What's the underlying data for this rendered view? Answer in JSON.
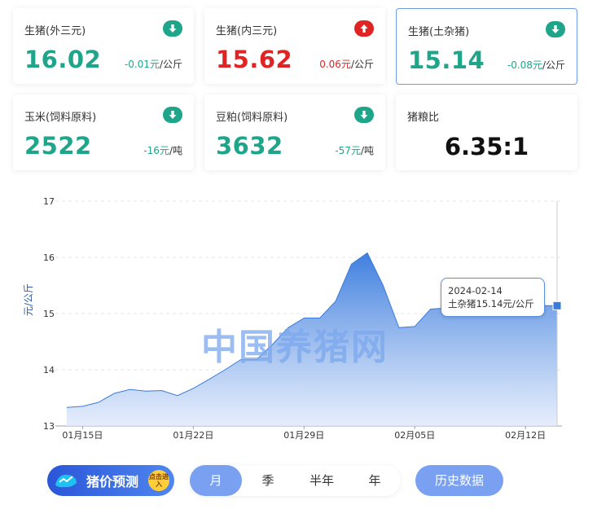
{
  "cards": [
    {
      "title": "生猪(外三元)",
      "price": "16.02",
      "change": "-0.01元",
      "unit": "/公斤",
      "trend": "down"
    },
    {
      "title": "生猪(内三元)",
      "price": "15.62",
      "change": "0.06元",
      "unit": "/公斤",
      "trend": "up"
    },
    {
      "title": "生猪(土杂猪)",
      "price": "15.14",
      "change": "-0.08元",
      "unit": "/公斤",
      "trend": "down"
    },
    {
      "title": "玉米(饲料原料)",
      "price": "2522",
      "change": "-16元",
      "unit": "/吨",
      "trend": "down"
    },
    {
      "title": "豆粕(饲料原料)",
      "price": "3632",
      "change": "-57元",
      "unit": "/吨",
      "trend": "down"
    },
    {
      "title": "猪粮比",
      "ratio": "6.35:1"
    }
  ],
  "colors": {
    "down": "#1ea58a",
    "up": "#e02424",
    "accent": "#7aa0f2",
    "line": "#3a7ad8"
  },
  "chart_data": {
    "type": "area",
    "ylabel": "元/公斤",
    "ylim": [
      13,
      17
    ],
    "yticks": [
      "13",
      "14",
      "15",
      "16",
      "17"
    ],
    "xticks": [
      "01月15日",
      "01月22日",
      "01月29日",
      "02月05日",
      "02月12日"
    ],
    "x": [
      "2024-01-14",
      "2024-01-15",
      "2024-01-16",
      "2024-01-17",
      "2024-01-18",
      "2024-01-19",
      "2024-01-20",
      "2024-01-21",
      "2024-01-22",
      "2024-01-23",
      "2024-01-24",
      "2024-01-25",
      "2024-01-26",
      "2024-01-27",
      "2024-01-28",
      "2024-01-29",
      "2024-01-30",
      "2024-01-31",
      "2024-02-01",
      "2024-02-02",
      "2024-02-03",
      "2024-02-04",
      "2024-02-05",
      "2024-02-06",
      "2024-02-07",
      "2024-02-08",
      "2024-02-09",
      "2024-02-10",
      "2024-02-11",
      "2024-02-12",
      "2024-02-13",
      "2024-02-14"
    ],
    "series": [
      {
        "name": "土杂猪",
        "values": [
          13.33,
          13.35,
          13.42,
          13.58,
          13.65,
          13.62,
          13.63,
          13.54,
          13.67,
          13.83,
          14.0,
          14.18,
          14.18,
          14.45,
          14.75,
          14.92,
          14.92,
          15.22,
          15.88,
          16.08,
          15.5,
          14.75,
          14.77,
          15.08,
          15.1,
          15.12,
          15.12,
          15.14,
          15.14,
          15.14,
          15.14,
          15.14
        ]
      }
    ],
    "tooltip": {
      "date": "2024-02-14",
      "text": "土杂猪15.14元/公斤"
    }
  },
  "watermark": "中国养猪网",
  "bottom": {
    "predict_label": "猪价预测",
    "predict_badge": "点击进入",
    "periods": [
      "月",
      "季",
      "半年",
      "年"
    ],
    "active_period": "月",
    "history_label": "历史数据"
  }
}
